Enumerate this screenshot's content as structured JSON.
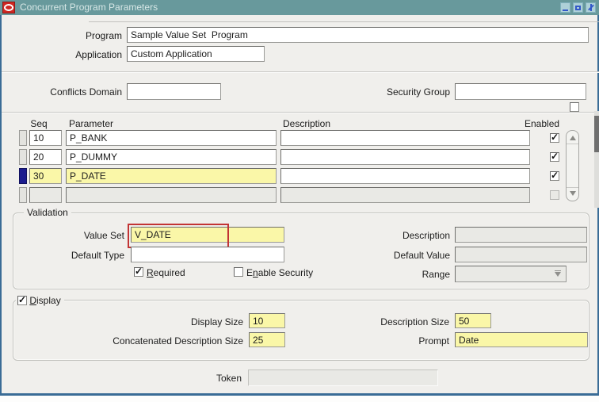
{
  "window": {
    "title": "Concurrent Program Parameters",
    "icon": "oracle-logo"
  },
  "colors": {
    "titlebar": "#68999c",
    "body": "#f0efec",
    "selected_field_yellow": "#faf7a8",
    "disabled_field_gray": "#e9e9e5",
    "annotation_red": "#c23434",
    "row_selector_blue": "#1b1b8e",
    "window_border_blue": "#3a6c96"
  },
  "header_fields": {
    "program_label": "Program",
    "program_value": "Sample Value Set  Program",
    "application_label": "Application",
    "application_value": "Custom Application"
  },
  "domain_row": {
    "conflicts_domain_label": "Conflicts Domain",
    "conflicts_domain_value": "",
    "security_group_label": "Security Group",
    "security_group_value": ""
  },
  "parameters_table": {
    "headers": {
      "seq": "Seq",
      "parameter": "Parameter",
      "description": "Description",
      "enabled": "Enabled"
    },
    "rows": [
      {
        "seq": "10",
        "parameter": "P_BANK",
        "description": "",
        "enabled": true,
        "selected": false,
        "disabled": false
      },
      {
        "seq": "20",
        "parameter": "P_DUMMY",
        "description": "",
        "enabled": true,
        "selected": false,
        "disabled": false
      },
      {
        "seq": "30",
        "parameter": "P_DATE",
        "description": "",
        "enabled": true,
        "selected": true,
        "disabled": false
      },
      {
        "seq": "",
        "parameter": "",
        "description": "",
        "enabled": false,
        "selected": false,
        "disabled": true
      }
    ]
  },
  "validation": {
    "section_label": "Validation",
    "value_set_label": "Value Set",
    "value_set_value": "V_DATE",
    "description_label": "Description",
    "description_value": "",
    "default_type_label": "Default Type",
    "default_type_value": "",
    "default_value_label": "Default Value",
    "default_value_value": "",
    "required_label": {
      "pre": "",
      "u": "R",
      "post": "equired"
    },
    "required_checked": true,
    "enable_security_label": {
      "pre": "E",
      "u": "n",
      "post": "able Security"
    },
    "enable_security_checked": false,
    "range_label": "Range",
    "range_value": ""
  },
  "display_section": {
    "section_label": {
      "pre": "",
      "u": "D",
      "post": "isplay"
    },
    "section_checked": true,
    "display_size_label": "Display Size",
    "display_size_value": "10",
    "description_size_label": "Description Size",
    "description_size_value": "50",
    "concatenated_label": "Concatenated Description Size",
    "concatenated_value": "25",
    "prompt_label": "Prompt",
    "prompt_value": "Date"
  },
  "token_row": {
    "token_label": "Token",
    "token_value": ""
  }
}
